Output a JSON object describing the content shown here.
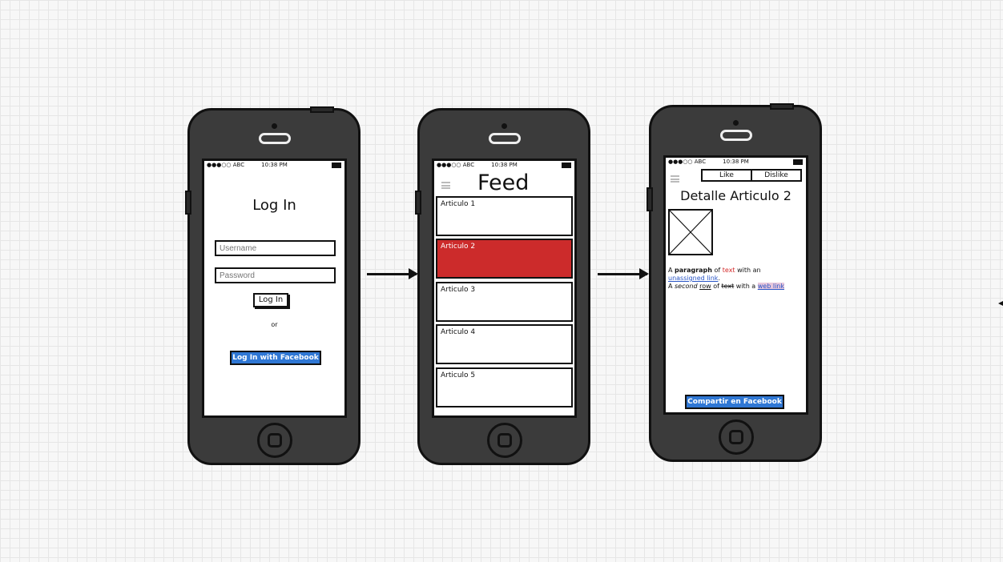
{
  "status_bar": {
    "carrier": "●●●○○ ABC",
    "time": "10:38 PM"
  },
  "login_screen": {
    "title": "Log In",
    "username_placeholder": "Username",
    "password_placeholder": "Password",
    "login_label": "Log In",
    "or_label": "or",
    "facebook_label": "Log In with Facebook"
  },
  "feed_screen": {
    "title": "Feed",
    "items": [
      "Articulo 1",
      "Articulo 2",
      "Articulo 3",
      "Articulo 4",
      "Articulo 5"
    ],
    "selected_item": "Articulo 2"
  },
  "detail_screen": {
    "like_label": "Like",
    "dislike_label": "Dislike",
    "title": "Detalle Articulo 2",
    "paragraph": {
      "p1": "A ",
      "p2_bold": "paragraph",
      "p3": " of ",
      "p4_red": "text",
      "p5": " with an",
      "p6_link": "unassigned link",
      "p7": ".",
      "r1": "A ",
      "r2_italic": "second",
      "r3": " ",
      "r4_underline": "row",
      "r5": " of ",
      "r6_strike": "text",
      "r7": " with a ",
      "r8_link": "web link"
    },
    "share_label": "Compartir en Facebook"
  },
  "colors": {
    "selected_item": "#cc2b2b",
    "facebook_button": "#2f77d4",
    "phone_body": "#3b3b3b"
  }
}
